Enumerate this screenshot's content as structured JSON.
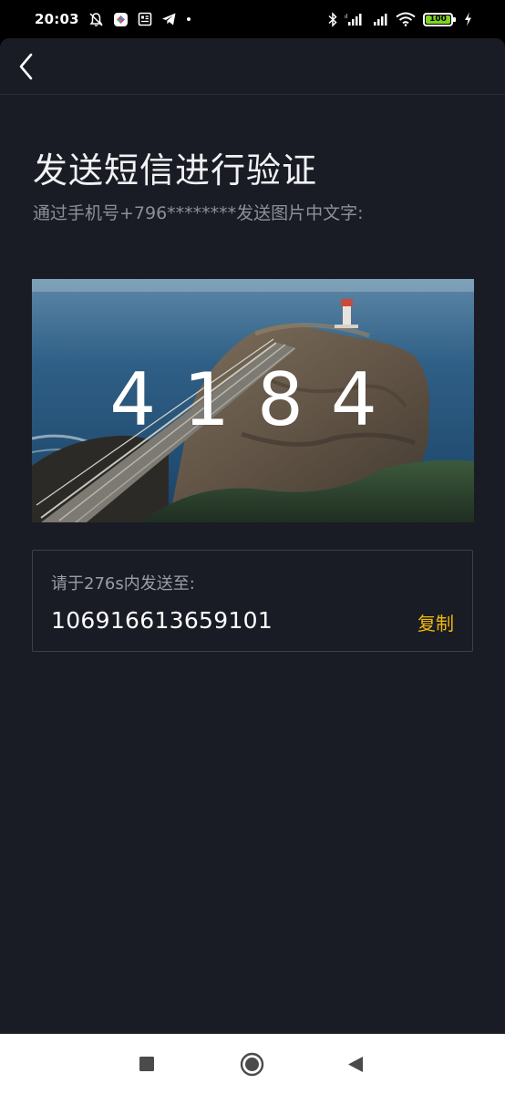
{
  "status_bar": {
    "time": "20:03",
    "battery_level": "100",
    "left_icons": [
      "muted-bell-icon",
      "app-logo-icon",
      "news-icon",
      "telegram-icon",
      "dot-icon"
    ],
    "right_icons": [
      "bluetooth-icon",
      "signal-icon",
      "signal-icon",
      "wifi-icon",
      "battery-icon",
      "charging-icon"
    ]
  },
  "header": {
    "back_icon": "chevron-left-icon"
  },
  "page": {
    "title": "发送短信进行验证",
    "subtitle": "通过手机号+796********发送图片中文字:"
  },
  "captcha": {
    "code": "4184"
  },
  "send_box": {
    "label": "请于276s内发送至:",
    "number": "106916613659101",
    "copy_label": "复制"
  },
  "colors": {
    "background": "#1a1c25",
    "accent": "#f0b90b",
    "text_primary": "#ffffff",
    "text_secondary": "#8c8f99"
  },
  "system_nav": {
    "buttons": [
      "square-recents-icon",
      "circle-home-icon",
      "triangle-back-icon"
    ]
  }
}
